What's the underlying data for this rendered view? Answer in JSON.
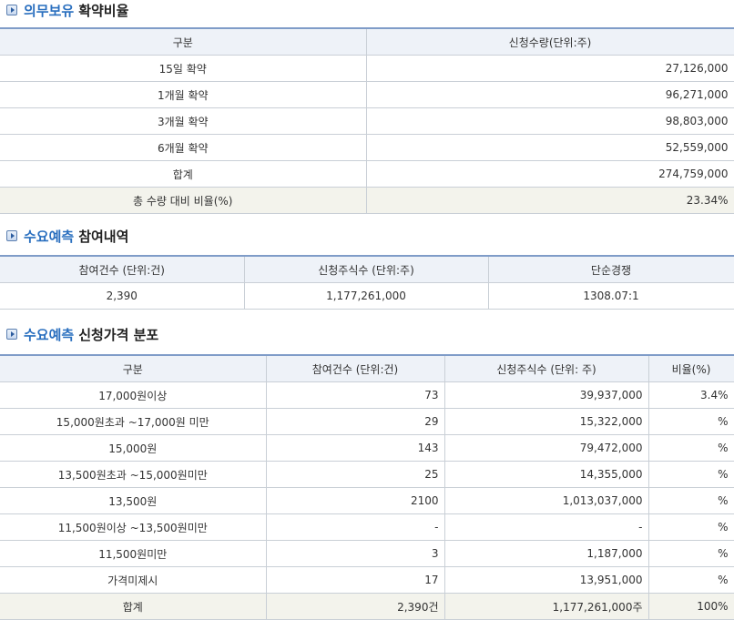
{
  "section1": {
    "accent": "의무보유",
    "title": "확약비율",
    "headers": [
      "구분",
      "신청수량(단위:주)"
    ],
    "rows": [
      {
        "label": "15일 확약",
        "value": "27,126,000"
      },
      {
        "label": "1개월 확약",
        "value": "96,271,000"
      },
      {
        "label": "3개월 확약",
        "value": "98,803,000"
      },
      {
        "label": "6개월 확약",
        "value": "52,559,000"
      },
      {
        "label": "합계",
        "value": "274,759,000"
      },
      {
        "label": "총 수량 대비 비율(%)",
        "value": "23.34%"
      }
    ]
  },
  "section2": {
    "accent": "수요예측",
    "title": "참여내역",
    "headers": [
      "참여건수 (단위:건)",
      "신청주식수 (단위:주)",
      "단순경쟁"
    ],
    "row": [
      "2,390",
      "1,177,261,000",
      "1308.07:1"
    ]
  },
  "section3": {
    "accent": "수요예측",
    "title": "신청가격 분포",
    "headers": [
      "구분",
      "참여건수 (단위:건)",
      "신청주식수 (단위: 주)",
      "비율(%)"
    ],
    "rows": [
      [
        "17,000원이상",
        "73",
        "39,937,000",
        "3.4%"
      ],
      [
        "15,000원초과 ~17,000원 미만",
        "29",
        "15,322,000",
        "%"
      ],
      [
        "15,000원",
        "143",
        "79,472,000",
        "%"
      ],
      [
        "13,500원초과 ~15,000원미만",
        "25",
        "14,355,000",
        "%"
      ],
      [
        "13,500원",
        "2100",
        "1,013,037,000",
        "%"
      ],
      [
        "11,500원이상 ~13,500원미만",
        "-",
        "-",
        "%"
      ],
      [
        "11,500원미만",
        "3",
        "1,187,000",
        "%"
      ],
      [
        "가격미제시",
        "17",
        "13,951,000",
        "%"
      ],
      [
        "합계",
        "2,390건",
        "1,177,261,000주",
        "100%"
      ]
    ]
  }
}
